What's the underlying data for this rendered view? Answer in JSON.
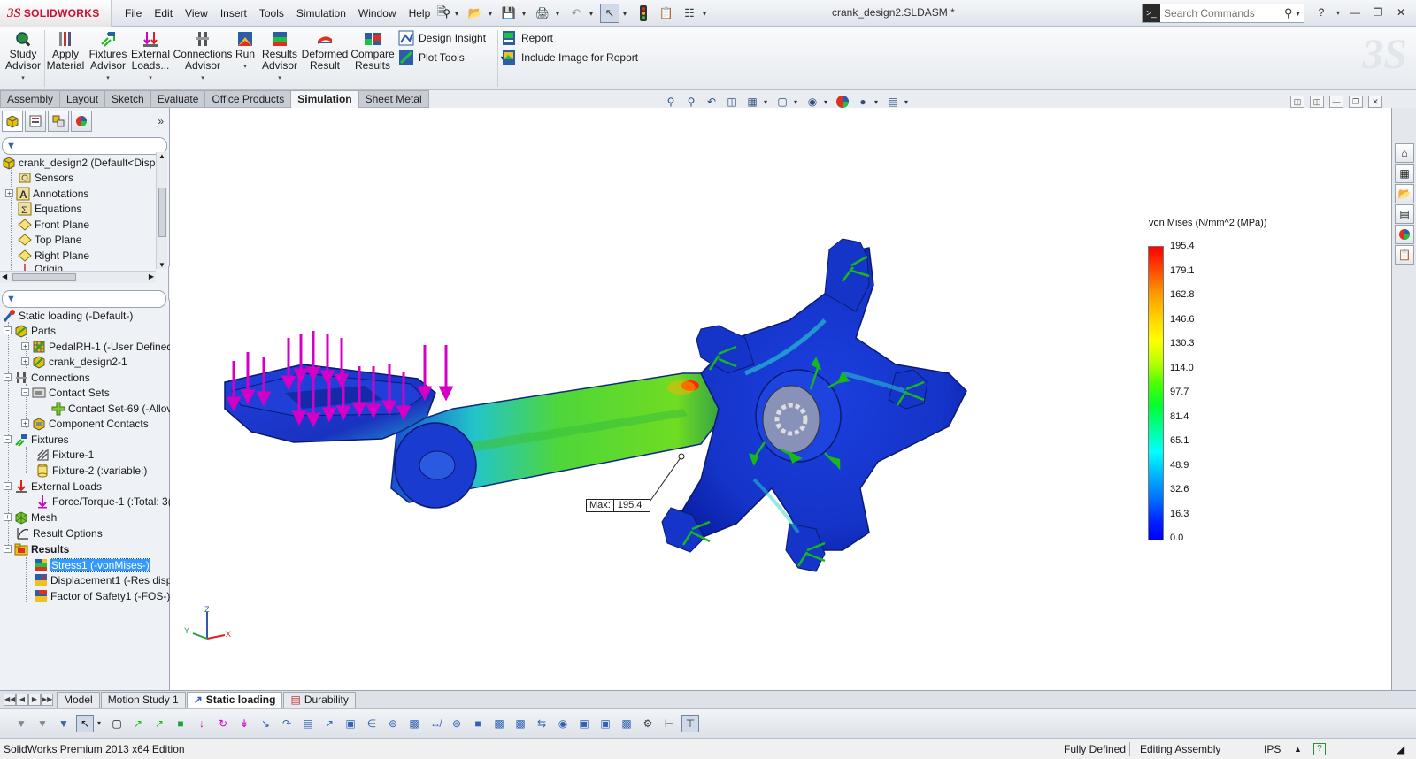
{
  "app": {
    "brand": "SOLIDWORKS",
    "document_title": "crank_design2.SLDASM *"
  },
  "menus": [
    "File",
    "Edit",
    "View",
    "Insert",
    "Tools",
    "Simulation",
    "Window",
    "Help"
  ],
  "search": {
    "placeholder": "Search Commands"
  },
  "command_manager": {
    "study_advisor": [
      "Study",
      "Advisor"
    ],
    "apply_material": [
      "Apply",
      "Material"
    ],
    "fixtures_advisor": [
      "Fixtures",
      "Advisor"
    ],
    "external_loads": [
      "External",
      "Loads..."
    ],
    "connections_advisor": [
      "Connections",
      "Advisor"
    ],
    "run": [
      "Run"
    ],
    "results_advisor": [
      "Results",
      "Advisor"
    ],
    "deformed_result": [
      "Deformed",
      "Result"
    ],
    "compare_results": [
      "Compare",
      "Results"
    ],
    "design_insight": "Design Insight",
    "plot_tools": "Plot Tools",
    "report": "Report",
    "include_image": "Include Image for Report"
  },
  "command_tabs": [
    "Assembly",
    "Layout",
    "Sketch",
    "Evaluate",
    "Office Products",
    "Simulation",
    "Sheet Metal"
  ],
  "active_command_tab": "Simulation",
  "feature_tree": {
    "root": "crank_design2  (Default<Displ",
    "items": [
      "Sensors",
      "Annotations",
      "Equations",
      "Front Plane",
      "Top Plane",
      "Right Plane",
      "Origin"
    ]
  },
  "study_tree": {
    "root": "Static loading (-Default-)",
    "parts": "Parts",
    "part1": "PedalRH-1 (-User Defined",
    "part2": "crank_design2-1",
    "connections": "Connections",
    "contact_sets": "Contact Sets",
    "contact_set": "Contact Set-69 (-Allov",
    "component_contacts": "Component Contacts",
    "fixtures": "Fixtures",
    "fixture1": "Fixture-1",
    "fixture2": "Fixture-2 (:variable:)",
    "external_loads": "External Loads",
    "force": "Force/Torque-1 (:Total: 3(",
    "mesh": "Mesh",
    "result_options": "Result Options",
    "results": "Results",
    "stress": "Stress1 (-vonMises-)",
    "displacement": "Displacement1 (-Res disp-",
    "fos": "Factor of Safety1 (-FOS-)"
  },
  "legend": {
    "title": "von Mises (N/mm^2 (MPa))",
    "ticks": [
      "195.4",
      "179.1",
      "162.8",
      "146.6",
      "130.3",
      "114.0",
      "97.7",
      "81.4",
      "65.1",
      "48.9",
      "32.6",
      "16.3",
      "0.0"
    ],
    "colors": {
      "max": "#ff0000",
      "min": "#0000ff"
    }
  },
  "probe": {
    "label": "Max:",
    "value": "195.4"
  },
  "triad": {
    "x": "X",
    "y": "Y",
    "z": "Z"
  },
  "model_tabs": [
    "Model",
    "Motion Study 1",
    "Static loading",
    "Durability"
  ],
  "active_model_tab": "Static loading",
  "status": {
    "edition": "SolidWorks Premium 2013 x64 Edition",
    "state": "Fully Defined",
    "mode": "Editing Assembly",
    "units": "IPS"
  },
  "colors": {
    "brand_red": "#c8102e",
    "load_arrows": "#d400c8",
    "fixture_arrows": "#18b818",
    "selection": "#3399ff"
  }
}
